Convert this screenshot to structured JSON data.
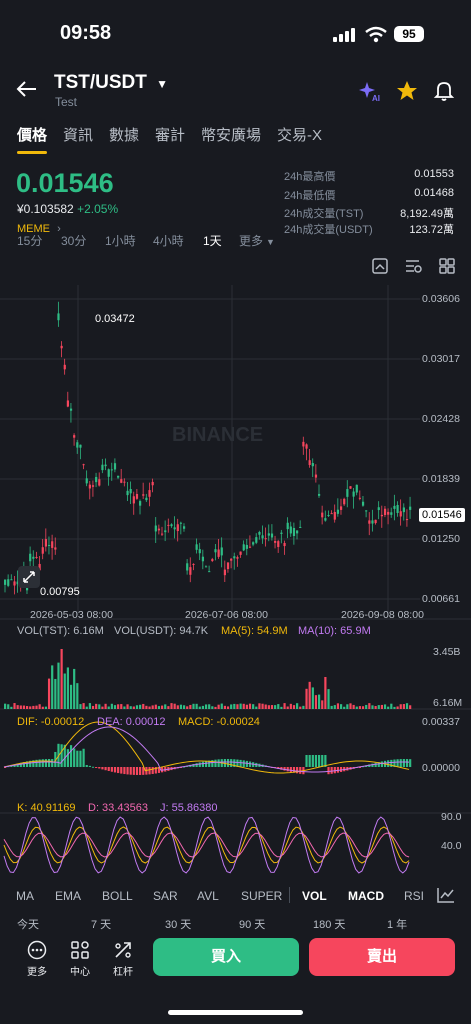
{
  "status_bar": {
    "time": "09:58",
    "battery": "95"
  },
  "header": {
    "pair": "TST/USDT",
    "subtitle": "Test"
  },
  "tabs": [
    "價格",
    "資訊",
    "數據",
    "審計",
    "幣安廣場",
    "交易-X"
  ],
  "price": {
    "last": "0.01546",
    "fiat": "¥0.103582",
    "change": "+2.05%",
    "tag": "MEME"
  },
  "stats": [
    {
      "label": "24h最高價",
      "value": "0.01553"
    },
    {
      "label": "24h最低價",
      "value": "0.01468"
    },
    {
      "label": "24h成交量(TST)",
      "value": "8,192.49萬"
    },
    {
      "label": "24h成交量(USDT)",
      "value": "123.72萬"
    }
  ],
  "timeframes": [
    "15分",
    "30分",
    "1小時",
    "4小時",
    "1天",
    "更多"
  ],
  "active_timeframe": "1天",
  "chart": {
    "y_ticks": [
      "0.03606",
      "0.03017",
      "0.02428",
      "0.01839",
      "0.01250",
      "0.00661"
    ],
    "current_price": "0.01546",
    "high_marker": "0.03472",
    "low_marker": "0.00795",
    "dates": [
      "2026-05-03 08:00",
      "2026-07-06 08:00",
      "2026-09-08 08:00"
    ],
    "watermark": "BINANCE"
  },
  "vol": {
    "a": "VOL(TST): 6.16M",
    "b": "VOL(USDT): 94.7K",
    "ma5": "MA(5): 54.9M",
    "ma10": "MA(10): 65.9M",
    "top": "3.45B",
    "bottom": "6.16M"
  },
  "macd": {
    "dif": "DIF: -0.00012",
    "dea": "DEA: 0.00012",
    "macd": "MACD: -0.00024",
    "top": "0.00337",
    "zero": "0.00000"
  },
  "kdj": {
    "k": "K: 40.91169",
    "d": "D: 33.43563",
    "j": "J: 55.86380",
    "top": "90.0",
    "mid": "40.0"
  },
  "indicator_tabs": [
    "MA",
    "EMA",
    "BOLL",
    "SAR",
    "AVL",
    "SUPER",
    "VOL",
    "MACD",
    "RSI"
  ],
  "ranges": [
    "今天",
    "7 天",
    "30 天",
    "90 天",
    "180 天",
    "1 年"
  ],
  "footer": {
    "more": "更多",
    "center": "中心",
    "leverage": "杠杆",
    "buy": "買入",
    "sell": "賣出"
  },
  "colors": {
    "up": "#2ebd85",
    "down": "#f6465d",
    "accent": "#f0b90b"
  }
}
